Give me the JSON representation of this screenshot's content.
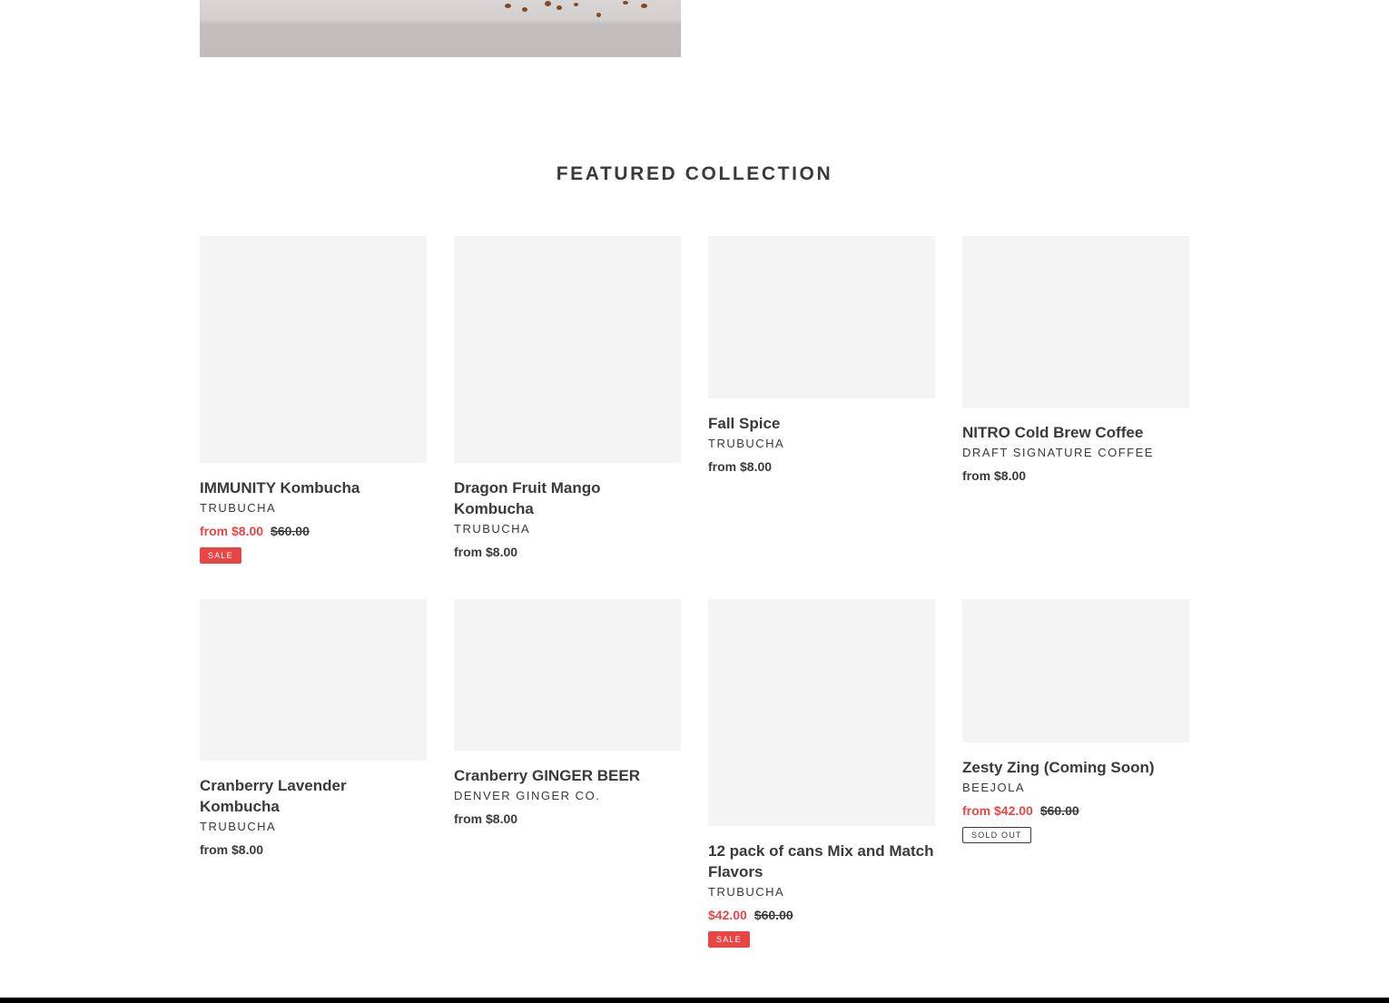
{
  "section": {
    "title": "Featured collection"
  },
  "colors": {
    "sale": "#e84545",
    "text": "#3a3a3a",
    "placeholder": "#f4f4f4",
    "footer": "#000000"
  },
  "products": [
    {
      "title": "IMMUNITY Kombucha",
      "vendor": "Trubucha",
      "price": "from $8.00",
      "compare_price": "$60.00",
      "badge": "Sale"
    },
    {
      "title": "Dragon Fruit Mango Kombucha",
      "vendor": "Trubucha",
      "price": "from $8.00"
    },
    {
      "title": "Fall Spice",
      "vendor": "Trubucha",
      "price": "from $8.00"
    },
    {
      "title": "NITRO Cold Brew Coffee",
      "vendor": "Draft Signature Coffee",
      "price": "from $8.00"
    },
    {
      "title": "Cranberry Lavender Kombucha",
      "vendor": "Trubucha",
      "price": "from $8.00"
    },
    {
      "title": "Cranberry GINGER BEER",
      "vendor": "Denver Ginger Co.",
      "price": "from $8.00"
    },
    {
      "title": "12 pack of cans Mix and Match Flavors",
      "vendor": "Trubucha",
      "price": "$42.00",
      "compare_price": "$60.00",
      "badge": "Sale"
    },
    {
      "title": "Zesty Zing (Coming Soon)",
      "vendor": "Beejola",
      "price": "from $42.00",
      "compare_price": "$60.00",
      "badge": "Sold out"
    }
  ]
}
